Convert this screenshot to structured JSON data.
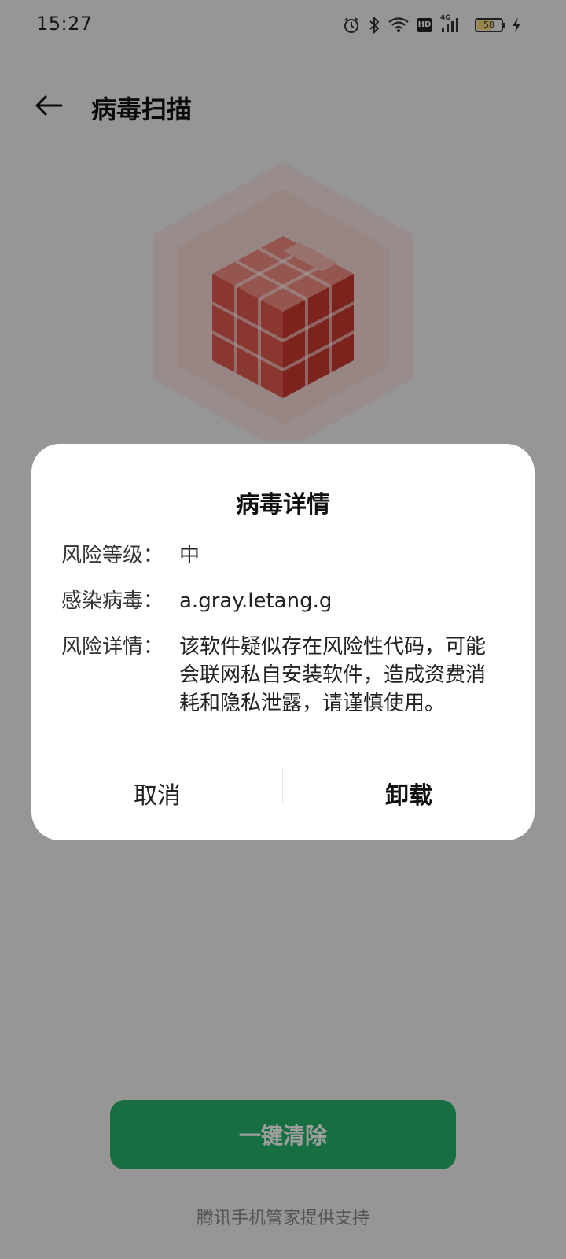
{
  "status_bar": {
    "time": "15:27",
    "icons": [
      "alarm-icon",
      "bluetooth-icon",
      "wifi-icon",
      "hd-icon",
      "cellular-4g-icon",
      "battery-icon",
      "charging-icon"
    ],
    "hd_label": "HD",
    "network_label": "4G",
    "battery_level": "58"
  },
  "header": {
    "back_icon": "arrow-left-icon",
    "title": "病毒扫描"
  },
  "hero": {
    "icon": "red-cube-virus-icon"
  },
  "dialog": {
    "title": "病毒详情",
    "rows": [
      {
        "label": "风险等级：",
        "value": "中"
      },
      {
        "label": "感染病毒：",
        "value": "a.gray.letang.g"
      },
      {
        "label": "风险详情：",
        "value": "该软件疑似存在风险性代码，可能会联网私自安装软件，造成资费消耗和隐私泄露，请谨慎使用。"
      }
    ],
    "cancel_label": "取消",
    "uninstall_label": "卸载"
  },
  "bottom": {
    "clean_button_label": "一键清除",
    "footer_text": "腾讯手机管家提供支持"
  },
  "colors": {
    "accent_green": "#26b36a",
    "virus_red": "#d9443c",
    "scrim": "rgba(0,0,0,0.38)"
  }
}
